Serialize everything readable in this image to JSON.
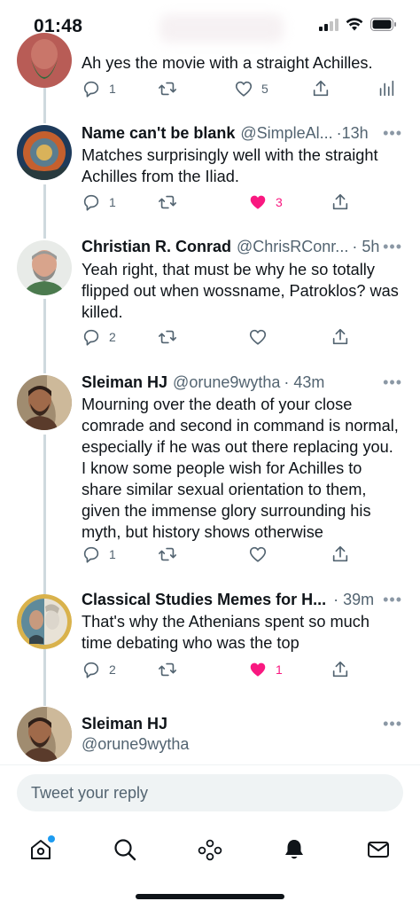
{
  "status_bar": {
    "time": "01:48"
  },
  "tweets": [
    {
      "text": "Ah yes the movie with a straight Achilles.",
      "reply_count": "1",
      "like_count": "5",
      "colors": {
        "skin": "#c9766a",
        "hair": "#3a2a26",
        "beard": "#2f6b3c",
        "bg": "#b85c56"
      }
    },
    {
      "name": "Name can't be blank",
      "handle": "@SimpleAl...",
      "time": "·13h",
      "text": "Matches surprisingly well with the straight\nAchilles from the Iliad.",
      "reply_count": "1",
      "like_count": "3",
      "liked": true
    },
    {
      "name": "Christian R. Conrad",
      "handle": "@ChrisRConr...",
      "time": "· 5h",
      "text": "Yeah right, that must be why he so totally\nflipped out when wossname, Patroklos? was\nkilled.",
      "reply_count": "2"
    },
    {
      "name": "Sleiman HJ",
      "handle": "@orune9wytha",
      "time": "· 43m",
      "text": "Mourning over the death of your close\ncomrade and second in command is normal,\nespecially if he was out there replacing you.\nI know some people wish for Achilles to\nshare similar sexual orientation to them,\ngiven the immense glory surrounding his\nmyth, but history shows otherwise",
      "reply_count": "1"
    },
    {
      "name": "Classical Studies Memes for H...",
      "time": "· 39m",
      "text": "That's why the Athenians spent so much\ntime debating who was the top",
      "reply_count": "2",
      "like_count": "1",
      "liked": true
    },
    {
      "name": "Sleiman HJ",
      "handle": "@orune9wytha"
    }
  ],
  "reply_box": {
    "placeholder": "Tweet your reply"
  },
  "tab_bar": {
    "tabs": [
      {
        "icon": "home-icon",
        "has_notification_dot": true
      },
      {
        "icon": "search-icon"
      },
      {
        "icon": "spaces-icon"
      },
      {
        "icon": "notifications-icon",
        "active": true
      },
      {
        "icon": "messages-icon"
      }
    ]
  },
  "theme": {
    "accent": "#1d9bf0",
    "like_color": "#f91880",
    "secondary_text": "#536471"
  }
}
